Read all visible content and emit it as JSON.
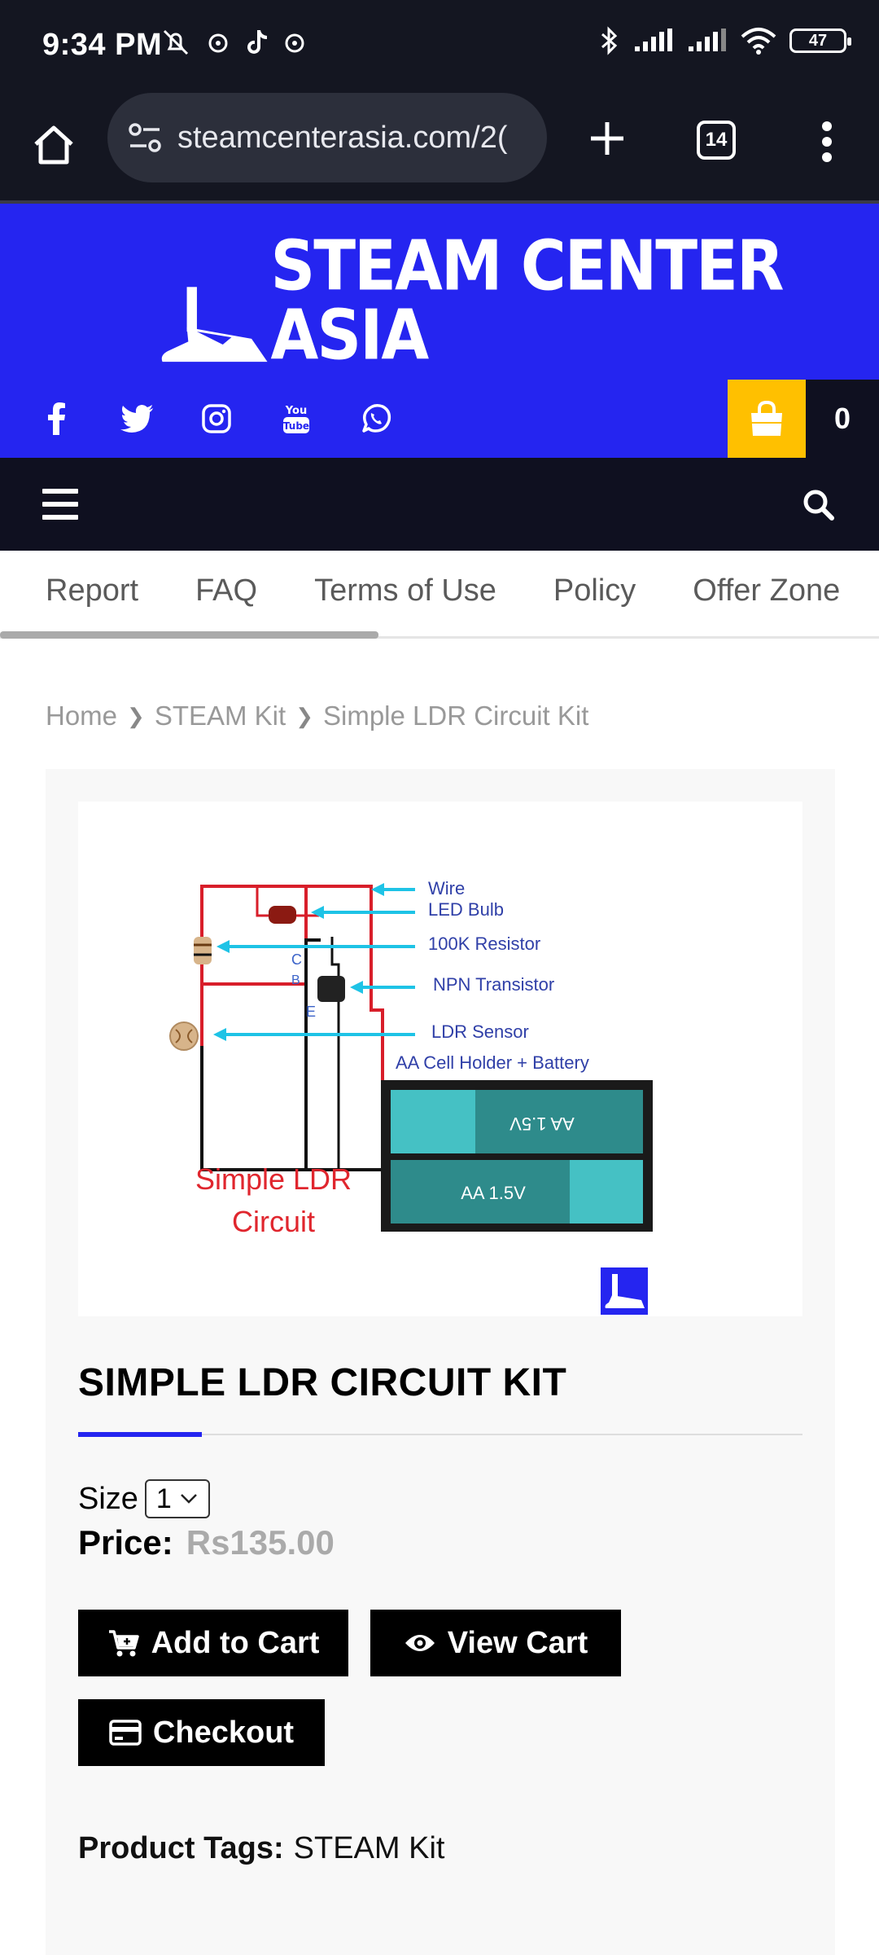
{
  "status_bar": {
    "time": "9:34 PM",
    "battery": "47"
  },
  "browser": {
    "url": "steamcenterasia.com/2(",
    "tab_count": "14"
  },
  "site": {
    "logo_text": "STEAM CENTER ASIA",
    "cart_count": "0",
    "social_icons": [
      "facebook-icon",
      "twitter-icon",
      "instagram-icon",
      "youtube-icon",
      "whatsapp-icon"
    ],
    "brand_color": "#2525f0",
    "cart_color": "#ffc000"
  },
  "menu": {
    "items": [
      "Report",
      "FAQ",
      "Terms of Use",
      "Policy",
      "Offer Zone"
    ]
  },
  "breadcrumb": {
    "home": "Home",
    "category": "STEAM Kit",
    "current": "Simple LDR Circuit Kit"
  },
  "product": {
    "image_labels": {
      "wire": "Wire",
      "led": "LED Bulb",
      "resistor": "100K Resistor",
      "transistor": "NPN Transistor",
      "ldr": "LDR Sensor",
      "holder": "AA Cell Holder + Battery",
      "battery1": "AA 1.5V",
      "battery2": "AA 1.5V",
      "pin_c": "C",
      "pin_b": "B",
      "pin_e": "E",
      "caption_line1": "Simple LDR",
      "caption_line2": "Circuit"
    },
    "title": "SIMPLE LDR CIRCUIT KIT",
    "size_label": "Size",
    "size_value": "1",
    "price_label": "Price:",
    "price_value": "Rs135.00",
    "add_to_cart": "Add to Cart",
    "view_cart": "View Cart",
    "checkout": "Checkout",
    "tags_label": "Product Tags:",
    "tags_value": "STEAM Kit"
  }
}
